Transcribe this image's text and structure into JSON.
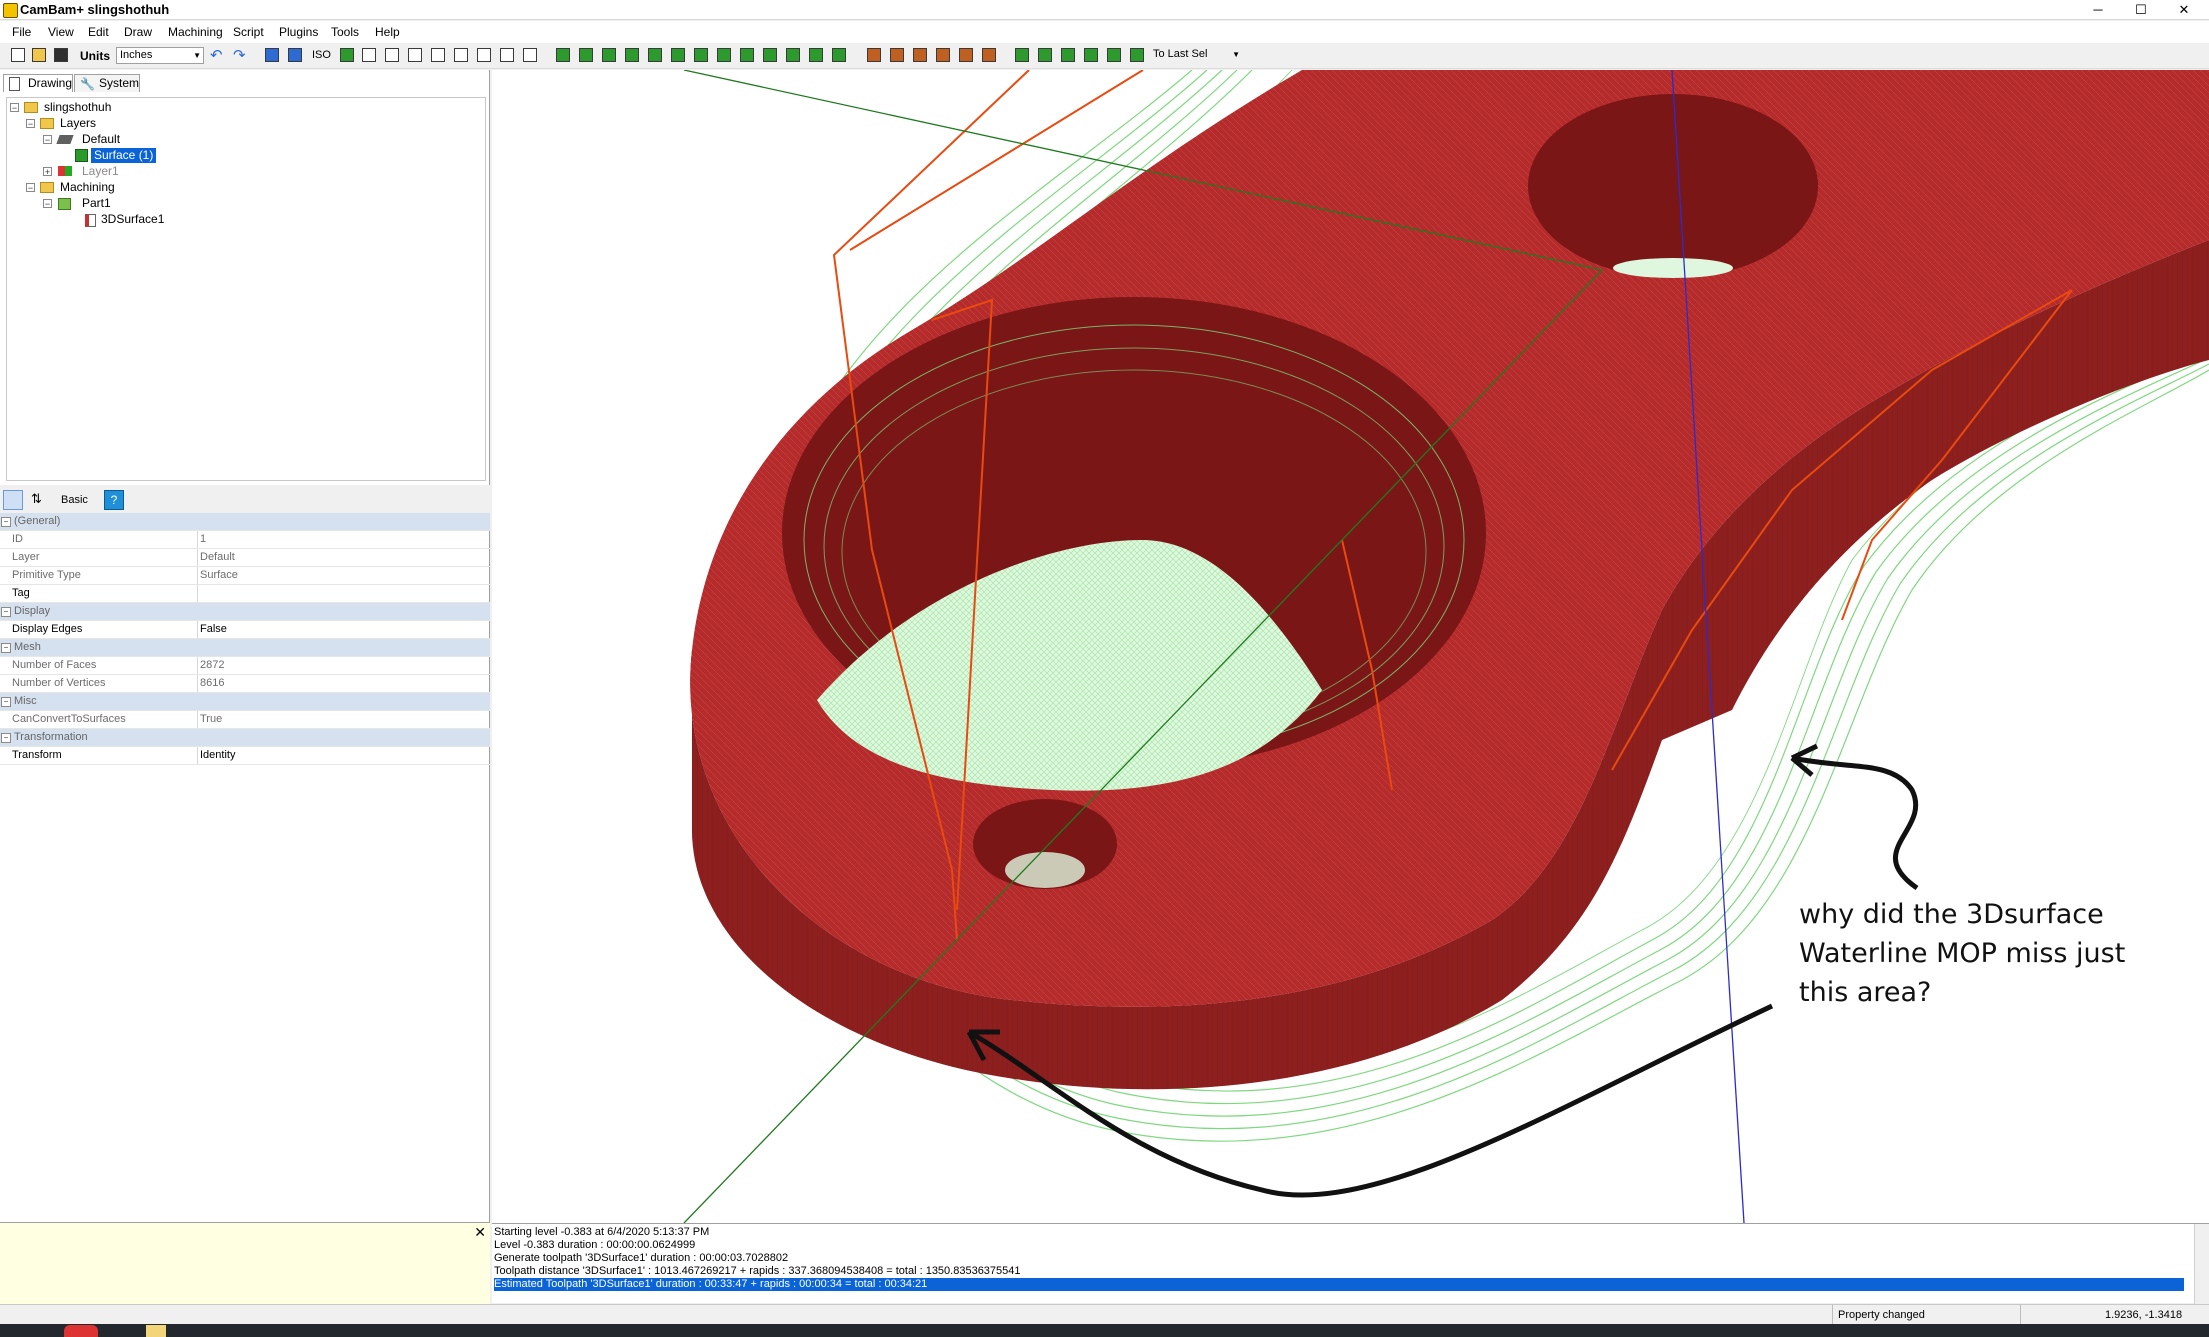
{
  "window": {
    "title": "CamBam+ slingshothuh",
    "minimize": "─",
    "maximize": "☐",
    "close": "✕"
  },
  "menu": [
    "File",
    "View",
    "Edit",
    "Draw",
    "Machining",
    "Script",
    "Plugins",
    "Tools",
    "Help"
  ],
  "toolbar": {
    "units_label": "Units",
    "units_value": "Inches",
    "iso_label": "ISO",
    "select_mode": "To Last Sel"
  },
  "tabs": {
    "drawing": "Drawing",
    "system": "System"
  },
  "tree": {
    "root": "slingshothuh",
    "layers": "Layers",
    "default_layer": "Default",
    "surface": "Surface (1)",
    "layer1": "Layer1",
    "machining": "Machining",
    "part1": "Part1",
    "mop": "3DSurface1"
  },
  "props_toolbar": {
    "basic": "Basic"
  },
  "properties": [
    {
      "kind": "cat",
      "key": "(General)"
    },
    {
      "kind": "row",
      "key": "ID",
      "value": "1",
      "readonly": true
    },
    {
      "kind": "row",
      "key": "Layer",
      "value": "Default",
      "readonly": true
    },
    {
      "kind": "row",
      "key": "Primitive Type",
      "value": "Surface",
      "readonly": true
    },
    {
      "kind": "row",
      "key": "Tag",
      "value": "",
      "readonly": false
    },
    {
      "kind": "cat",
      "key": "Display"
    },
    {
      "kind": "row",
      "key": "Display Edges",
      "value": "False",
      "readonly": false
    },
    {
      "kind": "cat",
      "key": "Mesh"
    },
    {
      "kind": "row",
      "key": "Number of Faces",
      "value": "2872",
      "readonly": true
    },
    {
      "kind": "row",
      "key": "Number of Vertices",
      "value": "8616",
      "readonly": true
    },
    {
      "kind": "cat",
      "key": "Misc"
    },
    {
      "kind": "row",
      "key": "CanConvertToSurfaces",
      "value": "True",
      "readonly": true
    },
    {
      "kind": "cat",
      "key": "Transformation"
    },
    {
      "kind": "row",
      "key": "Transform",
      "value": "Identity",
      "readonly": false
    }
  ],
  "log": [
    "Starting level -0.383 at 6/4/2020 5:13:37 PM",
    "Level -0.383 duration : 00:00:00.0624999",
    "Generate toolpath '3DSurface1' duration : 00:00:03.7028802",
    "Toolpath distance '3DSurface1' : 1013.467269217 + rapids : 337.368094538408 = total : 1350.83536375541",
    "Estimated Toolpath '3DSurface1' duration : 00:33:47 + rapids : 00:00:34 = total : 00:34:21"
  ],
  "status": {
    "message": "Property changed",
    "coords": "1.9236, -1.3418"
  },
  "annotation": {
    "line1": "why did the 3Dsurface",
    "line2": "Waterline MOP miss just",
    "line3": "this area?"
  },
  "colors": {
    "part_red": "#b52a2a",
    "toolpath_green": "#7fd87f",
    "rapid_orange": "#e84a10",
    "selection_blue": "#0a64d8",
    "axis_blue": "#2b2bd0",
    "axis_green": "#1f7a1f"
  }
}
